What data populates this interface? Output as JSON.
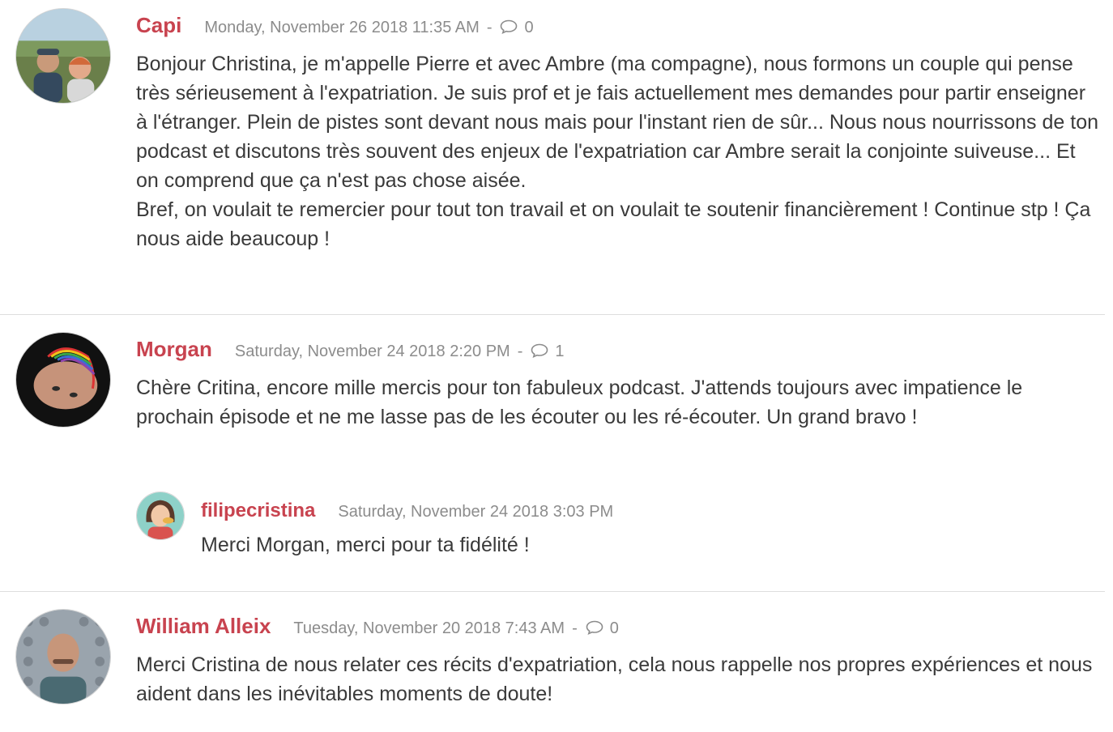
{
  "comments": [
    {
      "author": "Capi",
      "date": "Monday, November 26 2018 11:35 AM",
      "separator": "-",
      "reply_count": "0",
      "paragraphs": [
        "Bonjour Christina, je m'appelle Pierre et avec Ambre (ma compagne), nous formons un couple qui pense très sérieusement à l'expatriation. Je suis prof et je fais actuellement mes demandes pour partir enseigner à l'étranger. Plein de pistes sont devant nous mais pour l'instant rien de sûr... Nous nous nourrissons de ton podcast et discutons très souvent des enjeux de l'expatriation car Ambre serait la conjointe suiveuse... Et on comprend que ça n'est pas chose aisée.",
        "Bref, on voulait te remercier pour tout ton travail et on voulait te soutenir financièrement ! Continue stp ! Ça nous aide beaucoup !"
      ]
    },
    {
      "author": "Morgan",
      "date": "Saturday, November 24 2018 2:20 PM",
      "separator": "-",
      "reply_count": "1",
      "paragraphs": [
        "Chère Critina, encore mille mercis pour ton fabuleux podcast. J'attends toujours avec impatience le prochain épisode et ne me lasse pas de les écouter ou les ré-écouter. Un grand bravo !"
      ],
      "reply": {
        "author": "filipecristina",
        "date": "Saturday, November 24 2018 3:03 PM",
        "text": "Merci Morgan, merci pour ta fidélité !"
      }
    },
    {
      "author": "William Alleix",
      "date": "Tuesday, November 20 2018 7:43 AM",
      "separator": "-",
      "reply_count": "0",
      "paragraphs": [
        "Merci Cristina de nous relater ces récits d'expatriation, cela nous rappelle nos propres expériences et nous aident dans les inévitables moments de doute!"
      ]
    }
  ],
  "colors": {
    "author": "#c8434f",
    "meta": "#8c8c8c",
    "text": "#3a3a3a",
    "divider": "#dedede"
  },
  "icons": {
    "reply_count": "speech-bubble-icon"
  }
}
